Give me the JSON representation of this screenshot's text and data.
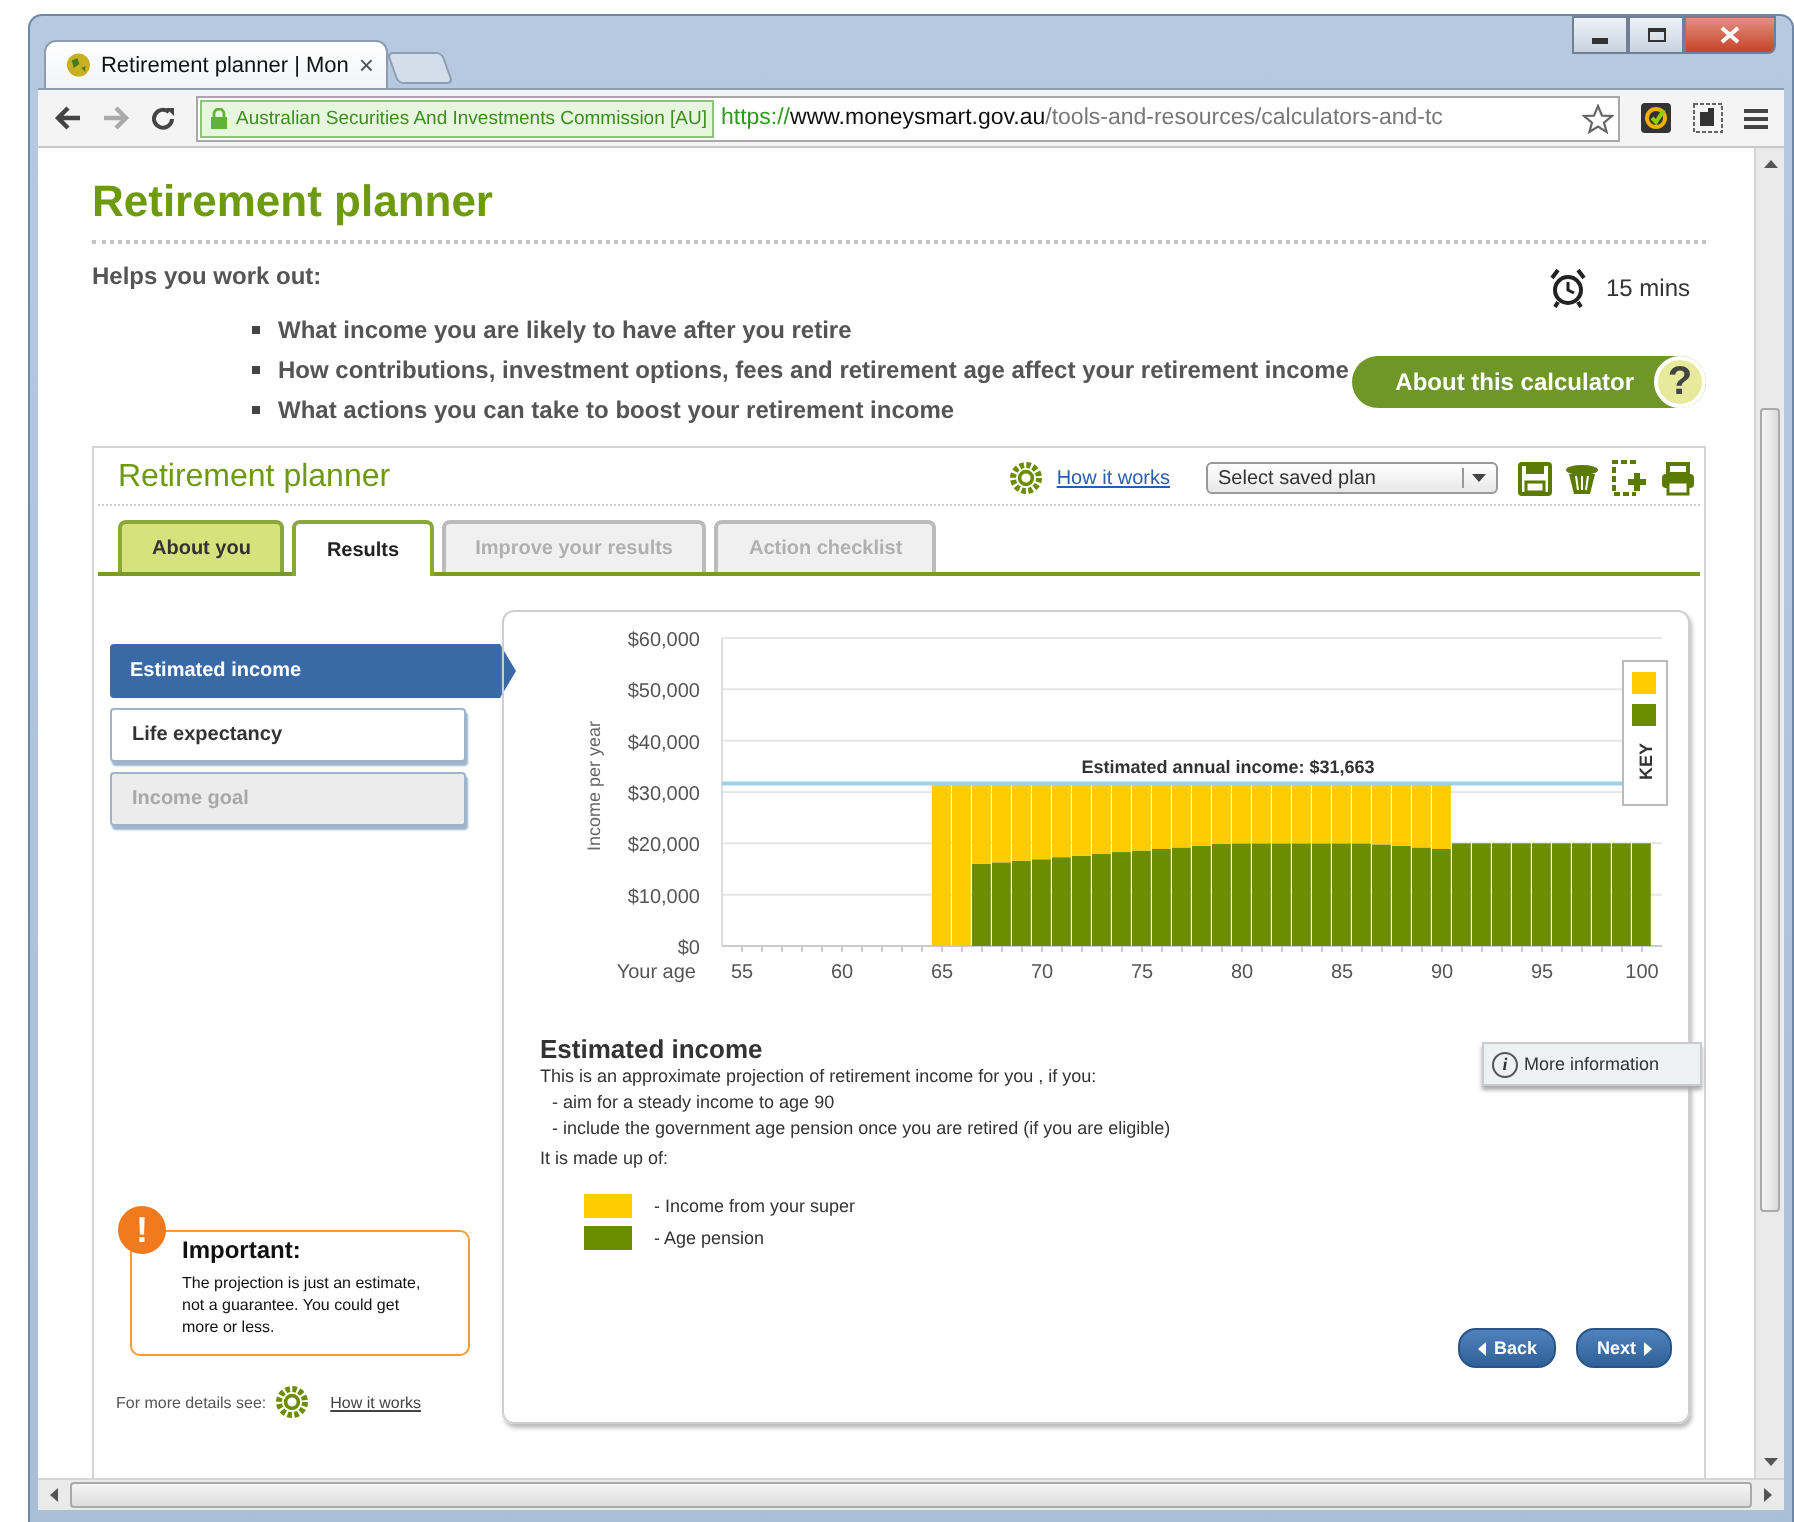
{
  "browser": {
    "tab_title": "Retirement planner | Mon",
    "tab_close": "×",
    "security_label": "Australian Securities And Investments Commission [AU]",
    "url_scheme": "https://",
    "url_host": "www.moneysmart.gov.au",
    "url_path": "/tools-and-resources/calculators-and-tc"
  },
  "page": {
    "title": "Retirement planner",
    "intro": "Helps you work out:",
    "duration": "15 mins",
    "bullets": [
      "What income you are likely to have after you retire",
      "How contributions, investment options, fees and retirement age affect your retirement income",
      "What actions you can take to boost your retirement income"
    ],
    "about_button": "About this calculator",
    "about_icon": "?"
  },
  "calculator": {
    "title": "Retirement planner",
    "how_it_works": "How it works",
    "plan_select": {
      "placeholder": "Select saved plan"
    },
    "tabs": [
      {
        "label": "About you",
        "selected": false,
        "disabled": false
      },
      {
        "label": "Results",
        "selected": true,
        "disabled": false
      },
      {
        "label": "Improve your results",
        "selected": false,
        "disabled": true
      },
      {
        "label": "Action checklist",
        "selected": false,
        "disabled": true
      }
    ],
    "nav": [
      {
        "label": "Estimated income",
        "selected": true,
        "disabled": false
      },
      {
        "label": "Life expectancy",
        "selected": false,
        "disabled": false
      },
      {
        "label": "Income goal",
        "selected": false,
        "disabled": true
      }
    ],
    "important": {
      "icon": "!",
      "title": "Important:",
      "text": "The projection is just an estimate, not a guarantee. You could get more or less."
    },
    "details_label": "For more details see:",
    "details_link": "How it works",
    "results": {
      "chart_key": "KEY",
      "chart_data": {
        "type": "bar",
        "stacked": true,
        "grid": true,
        "xlabel": "Your age",
        "ylabel": "Income per year",
        "x": [
          65,
          66,
          67,
          68,
          69,
          70,
          71,
          72,
          73,
          74,
          75,
          76,
          77,
          78,
          79,
          80,
          81,
          82,
          83,
          84,
          85,
          86,
          87,
          88,
          89,
          90,
          91,
          92,
          93,
          94,
          95,
          96,
          97,
          98,
          99,
          100
        ],
        "series": [
          {
            "name": "- Age pension",
            "color": "#6b8e00",
            "values": [
              null,
              null,
              16000,
              16300,
              16600,
              16900,
              17300,
              17600,
              18000,
              18300,
              18600,
              18900,
              19200,
              19500,
              19900,
              20000,
              20000,
              20000,
              20000,
              20000,
              20000,
              20000,
              19800,
              19500,
              19200,
              18900,
              20000,
              20000,
              20000,
              20000,
              20000,
              20000,
              20000,
              20000,
              20000,
              20000
            ]
          },
          {
            "name": "- Income from your super",
            "color": "#ffcc00",
            "values": [
              31700,
              31700,
              15700,
              15400,
              15100,
              14800,
              14400,
              14100,
              13700,
              13400,
              13100,
              12800,
              12500,
              12200,
              11800,
              11700,
              11700,
              11700,
              11700,
              11700,
              11700,
              11700,
              11900,
              12200,
              12500,
              12800,
              null,
              null,
              null,
              null,
              null,
              null,
              null,
              null,
              null,
              null
            ]
          }
        ],
        "xlim": [
          54,
          101
        ],
        "ylim": [
          0,
          60000
        ],
        "xticks": [
          55,
          60,
          65,
          70,
          75,
          80,
          85,
          90,
          95,
          100
        ],
        "yticks": [
          {
            "value": 0,
            "label": "$0"
          },
          {
            "value": 10000,
            "label": "$10,000"
          },
          {
            "value": 20000,
            "label": "$20,000"
          },
          {
            "value": 30000,
            "label": "$30,000"
          },
          {
            "value": 40000,
            "label": "$40,000"
          },
          {
            "value": 50000,
            "label": "$50,000"
          },
          {
            "value": 60000,
            "label": "$60,000"
          }
        ],
        "ref_lines": [
          {
            "axis": "y",
            "value": 31663,
            "label": "Estimated annual income: $31,663"
          }
        ]
      },
      "heading": "Estimated income",
      "more_info": "More information",
      "more_info_icon": "i",
      "intro": "This is an approximate projection of retirement income for you , if you:",
      "conditions": [
        "- aim for a steady income to age 90",
        "- include the government age pension once you are retired (if you are eligible)"
      ],
      "made_up": "It is made up of:",
      "back": "Back",
      "next": "Next"
    }
  }
}
